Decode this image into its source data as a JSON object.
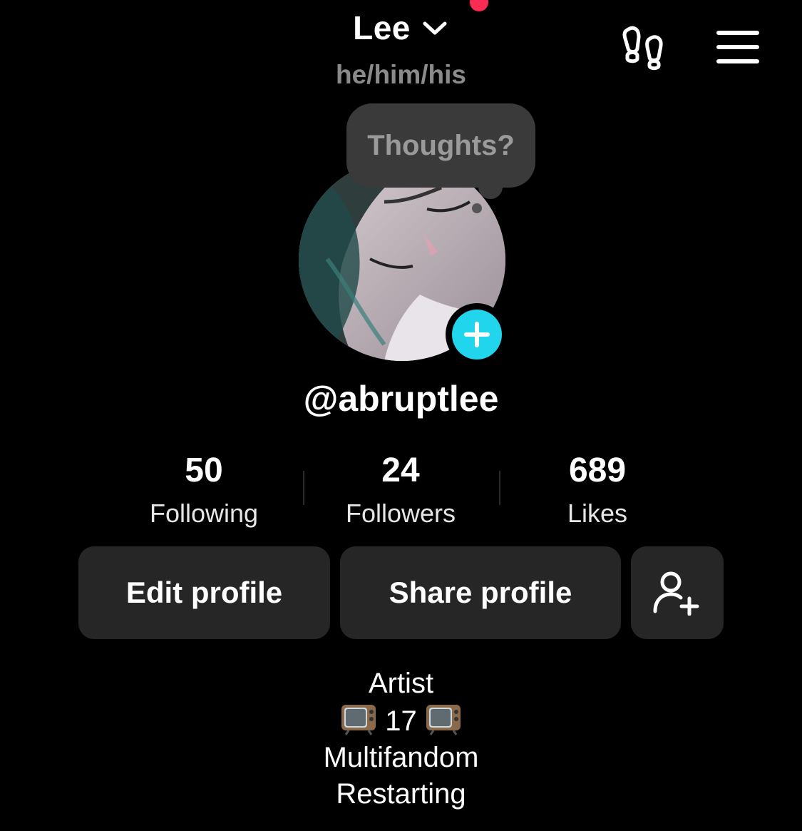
{
  "header": {
    "username": "Lee",
    "pronouns": "he/him/his",
    "icons": {
      "switch_account": "chevron-down-icon",
      "notification": "notification-dot",
      "visitors": "footprints-icon",
      "menu": "hamburger-menu-icon"
    }
  },
  "profile": {
    "thought_bubble": "Thoughts?",
    "handle": "@abruptlee",
    "add_avatar_icon": "plus-icon"
  },
  "stats": [
    {
      "value": "50",
      "label": "Following"
    },
    {
      "value": "24",
      "label": "Followers"
    },
    {
      "value": "689",
      "label": "Likes"
    }
  ],
  "actions": {
    "edit_profile": "Edit profile",
    "share_profile": "Share profile",
    "add_friends_icon": "add-user-icon"
  },
  "bio": {
    "line1": "Artist",
    "line2_number": "17",
    "line2_emoji": "television-icon",
    "line3": "Multifandom",
    "line4": "Restarting"
  },
  "colors": {
    "background": "#000000",
    "accent_cyan": "#20d5ec",
    "notification_red": "#fe2c55",
    "button_bg": "#262626",
    "muted_text": "#8a8a8a"
  }
}
